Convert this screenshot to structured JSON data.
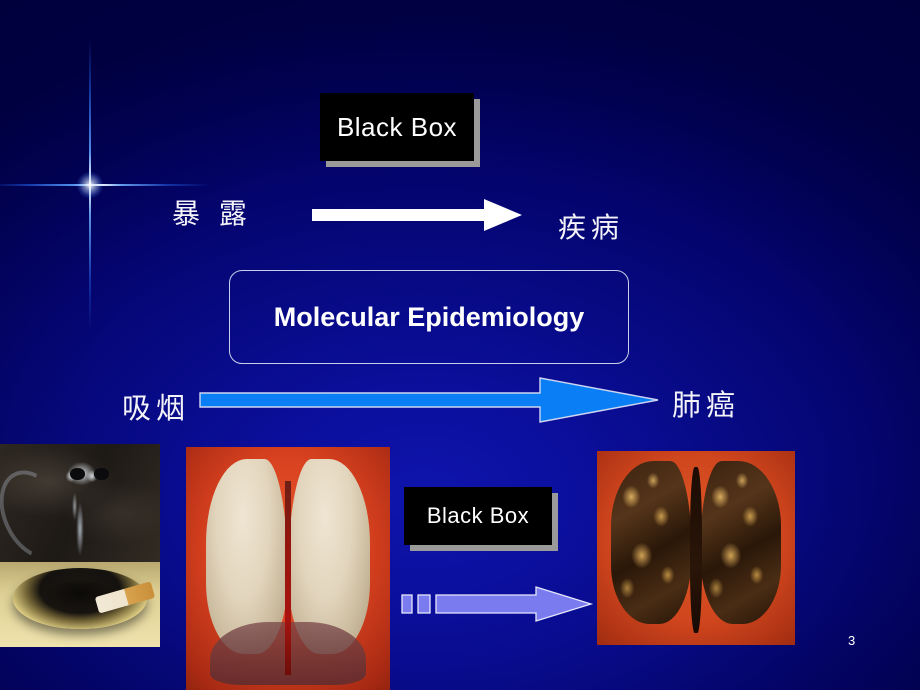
{
  "slide": {
    "page_number": "3",
    "background_color": "#0a0f9e",
    "background_edge_color": "#000049"
  },
  "top_section": {
    "black_box_label": "Black Box",
    "exposure_label": "暴 露",
    "disease_label": "疾病",
    "arrow_color": "#ffffff",
    "arrow_name": "exposure-to-disease-arrow"
  },
  "callout": {
    "label": "Molecular Epidemiology",
    "border_color": "#c9cfe8",
    "text_color": "#ffffff"
  },
  "bottom_section": {
    "smoking_label": "吸烟",
    "lung_cancer_label": "肺癌",
    "arrow_color": "#0a7ff5",
    "black_box_label": "Black Box",
    "dashed_arrow_color": "#7b7bf0"
  },
  "images": {
    "ashtray": {
      "name": "cigarette-ashtray-smoke-skull-photo",
      "alt": "Cigarette burning in an ashtray with smoke forming a skull"
    },
    "healthy_lungs": {
      "name": "healthy-lungs-photo",
      "alt": "Pair of healthy pale lungs on red background"
    },
    "diseased_lungs": {
      "name": "diseased-smoker-lungs-photo",
      "alt": "Pair of blackened diseased smoker lungs on red background"
    }
  }
}
